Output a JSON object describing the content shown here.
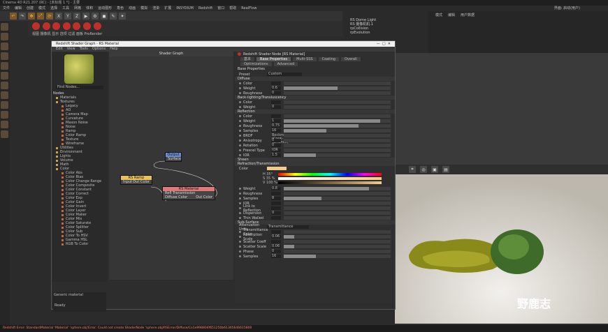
{
  "app": {
    "title": "Cinema 4D R21.207 (RC) - [未标题 1 *] - 主要",
    "menu": [
      "文件",
      "编辑",
      "创建",
      "模式",
      "选择",
      "工具",
      "网格",
      "体积",
      "运动图形",
      "角色",
      "动画",
      "模拟",
      "渲染",
      "扩展",
      "INSYDIUM",
      "Redshift",
      "窗口",
      "帮助",
      "RealFlow"
    ],
    "layout_label": "界面: 启动(用户)",
    "status": "Redshift Error: StandardMaterial 'Material' 'sphere.obj'Error: Could not create ShaderNode 'sphere.obj/RSError/Diffuse/Co1e998804f651250b61365646615800"
  },
  "objects": [
    "RS Dome Light",
    "RS 摄像机机.1",
    "rpCollision",
    "rpEvolution"
  ],
  "right_tabs": [
    "模式",
    "编辑",
    "用户数据"
  ],
  "shader_window": {
    "title": "Redshift Shader Graph - RS Material",
    "menu": [
      "Edit",
      "View",
      "Tools",
      "Options",
      "Help"
    ],
    "graph_title": "Shader Graph",
    "find_nodes": "Find Nodes...",
    "nodes_label": "Nodes",
    "tree": [
      {
        "label": "Materials",
        "level": 1
      },
      {
        "label": "Textures",
        "level": 1
      },
      {
        "label": "Legacy",
        "level": 2
      },
      {
        "label": "AO",
        "level": 2
      },
      {
        "label": "Camera Map",
        "level": 2
      },
      {
        "label": "Curvature",
        "level": 2
      },
      {
        "label": "Maxon Noise",
        "level": 2
      },
      {
        "label": "Noise",
        "level": 2
      },
      {
        "label": "Ramp",
        "level": 2
      },
      {
        "label": "Color Ramp",
        "level": 2
      },
      {
        "label": "Texture",
        "level": 2
      },
      {
        "label": "Wireframe",
        "level": 2
      },
      {
        "label": "Utilities",
        "level": 1
      },
      {
        "label": "Environment",
        "level": 1
      },
      {
        "label": "Lights",
        "level": 1
      },
      {
        "label": "Volume",
        "level": 1
      },
      {
        "label": "Math",
        "level": 1
      },
      {
        "label": "Color",
        "level": 1
      },
      {
        "label": "Color Abs",
        "level": 2
      },
      {
        "label": "Color Bias",
        "level": 2
      },
      {
        "label": "Color Change Range",
        "level": 2
      },
      {
        "label": "Color Composite",
        "level": 2
      },
      {
        "label": "Color Constant",
        "level": 2
      },
      {
        "label": "Color Correct",
        "level": 2
      },
      {
        "label": "Color Exp",
        "level": 2
      },
      {
        "label": "Color Gain",
        "level": 2
      },
      {
        "label": "Color Invert",
        "level": 2
      },
      {
        "label": "Color Layer",
        "level": 2
      },
      {
        "label": "Color Maker",
        "level": 2
      },
      {
        "label": "Color Mix",
        "level": 2
      },
      {
        "label": "Color Saturate",
        "level": 2
      },
      {
        "label": "Color Splitter",
        "level": 2
      },
      {
        "label": "Color Sub",
        "level": 2
      },
      {
        "label": "Color To HSV",
        "level": 2
      },
      {
        "label": "Gamma HSL",
        "level": 2
      },
      {
        "label": "RGB To Color",
        "level": 2
      }
    ],
    "description": "Generic material",
    "footer": "Ready",
    "nodes": {
      "output": {
        "title": "Output",
        "port": "Surface"
      },
      "ramp": {
        "title": "RS Ramp",
        "in": "Input",
        "out": "Out Color"
      },
      "material": {
        "title": "RS Material",
        "p1": "Refl Transmission",
        "p2": "Diffuse Color",
        "out": "Out Color"
      }
    }
  },
  "props": {
    "header": "Redshift Shader Node [RS Material]",
    "tabs": [
      "基本",
      "Base Properties",
      "Multi-SSS",
      "Coating",
      "Overall",
      "Optimizations",
      "Advanced"
    ],
    "active_tab": "Base Properties",
    "section_title": "Base Properties",
    "preset_label": "Preset",
    "preset_value": "Custom",
    "diffuse": {
      "title": "Diffuse",
      "rows": [
        {
          "label": "Color",
          "value": ""
        },
        {
          "label": "Weight",
          "value": "0.6"
        },
        {
          "label": "Roughness",
          "value": "0"
        }
      ]
    },
    "back_lighting": {
      "title": "Back-lighting/Transluscency",
      "rows": [
        {
          "label": "Color",
          "value": ""
        },
        {
          "label": "Weight",
          "value": "0"
        }
      ]
    },
    "reflection": {
      "title": "Reflection",
      "rows": [
        {
          "label": "Color",
          "value": ""
        },
        {
          "label": "Weight",
          "value": "1"
        },
        {
          "label": "Roughness",
          "value": "0.75"
        },
        {
          "label": "Samples",
          "value": "16"
        },
        {
          "label": "BRDF",
          "value": "Beckmann (Cook-Torrance)"
        },
        {
          "label": "Anisotropy",
          "value": "0"
        },
        {
          "label": "Rotation",
          "value": "0"
        },
        {
          "label": "Fresnel Type",
          "value": "IOR"
        },
        {
          "label": "IOR",
          "value": "1.5"
        }
      ]
    },
    "sheen_title": "Sheen",
    "refraction": {
      "title": "Refraction/Transmission",
      "color_label": "Color",
      "h": "H 35°",
      "s": "S 35 %",
      "v": "V 100 %",
      "rows": [
        {
          "label": "Weight",
          "value": "0.8"
        },
        {
          "label": "Roughness",
          "value": ""
        },
        {
          "label": "Samples",
          "value": "8"
        },
        {
          "label": "IOR",
          "value": ""
        },
        {
          "label": "Link to Reflection",
          "value": ""
        },
        {
          "label": "Dispersion",
          "value": "0"
        },
        {
          "label": "Thin Walled",
          "value": ""
        }
      ]
    },
    "sss": {
      "title": "Sub-Surface",
      "mode_label": "Attenuation Units",
      "mode_value": "Transmittance",
      "rows": [
        {
          "label": "Transmittance Color",
          "value": ""
        },
        {
          "label": "Absorption Scale",
          "value": "0.06"
        },
        {
          "label": "Scatter Coeff",
          "value": ""
        },
        {
          "label": "Scatter Scale",
          "value": "0.06"
        },
        {
          "label": "Phase",
          "value": "0"
        },
        {
          "label": "Samples",
          "value": "16"
        }
      ]
    }
  },
  "watermark": "野鹿志",
  "viewport_toolbar": "视图 摄像机 显示 选项 过滤 面板 ProRender",
  "colors": {
    "accent": "#ff9a2e",
    "ramp_node": "#e8c15a",
    "output_node": "#6a8fd8",
    "material_node": "#e07a7a",
    "error": "#ff6a5a"
  }
}
